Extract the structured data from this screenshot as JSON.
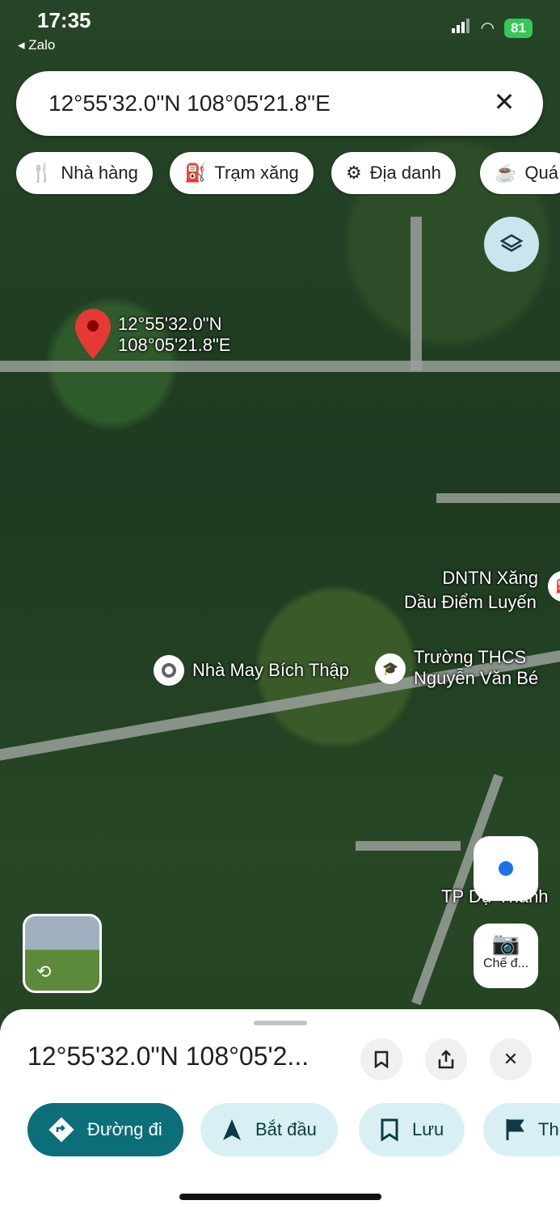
{
  "status_bar": {
    "time": "17:35",
    "back_app": "Zalo",
    "battery": "81"
  },
  "search": {
    "query": "12°55'32.0\"N 108°05'21.8\"E",
    "clear_icon": "close-icon"
  },
  "chips": [
    {
      "label": "Nhà hàng",
      "icon": "restaurant-icon"
    },
    {
      "label": "Trạm xăng",
      "icon": "gas-station-icon"
    },
    {
      "label": "Địa danh",
      "icon": "landmark-icon"
    },
    {
      "label": "Quá",
      "icon": "coffee-icon"
    }
  ],
  "map": {
    "pin_label_line1": "12°55'32.0\"N",
    "pin_label_line2": "108°05'21.8\"E",
    "places": {
      "gas_line1": "DNTN Xăng",
      "gas_line2": "Dầu Điểm Luyến",
      "sewing": "Nhà May Bích Thập",
      "school_line1": "Trường THCS",
      "school_line2": "Nguyễn Văn Bé",
      "city": "TP Dự Thành"
    }
  },
  "controls": {
    "lens_label": "Chế đ..."
  },
  "sheet": {
    "title": "12°55'32.0\"N 108°05'2...",
    "actions": [
      {
        "label": "Đường đi",
        "icon": "directions-icon",
        "bg": "#0b6e78",
        "fg": "#ffffff"
      },
      {
        "label": "Bắt đầu",
        "icon": "navigation-arrow-icon",
        "bg": "#d8f0f4",
        "fg": "#0d3b44"
      },
      {
        "label": "Lưu",
        "icon": "bookmark-icon",
        "bg": "#d8f0f4",
        "fg": "#0d3b44"
      },
      {
        "label": "Th",
        "icon": "flag-icon",
        "bg": "#d8f0f4",
        "fg": "#0d3b44"
      }
    ]
  }
}
